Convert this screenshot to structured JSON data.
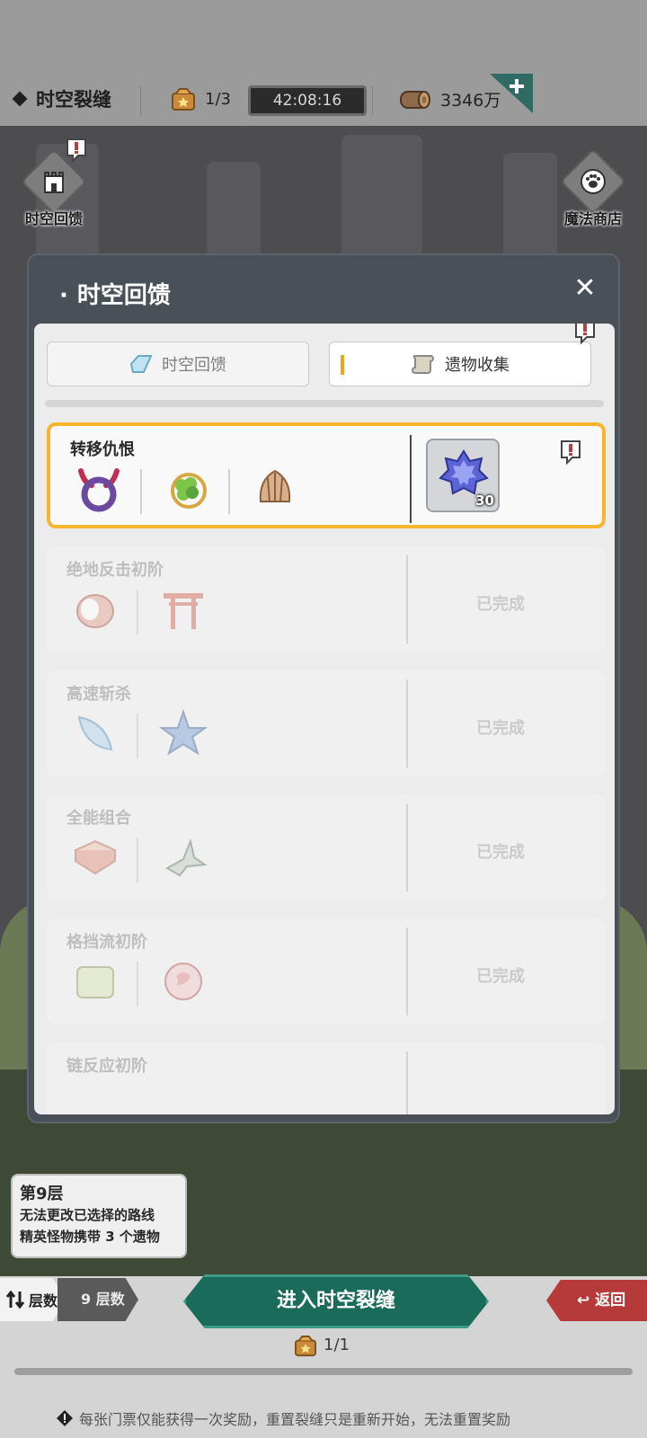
{
  "header": {
    "stage_name": "时空裂缝",
    "tickets": "1/3",
    "timer": "42:08:16",
    "wood_amount": "3346万"
  },
  "side_buttons": {
    "left_label": "时空回馈",
    "right_label": "魔法商店"
  },
  "modal": {
    "title": "时空回馈",
    "tabs": [
      {
        "label": "时空回馈",
        "icon": "crystal-icon",
        "selected": false
      },
      {
        "label": "遗物收集",
        "icon": "scroll-icon",
        "selected": true
      }
    ],
    "cards": [
      {
        "title": "转移仇恨",
        "status": "current",
        "reward_count": "30",
        "icons": [
          "horned-ring-icon",
          "clover-amulet-icon",
          "shell-icon"
        ]
      },
      {
        "title": "绝地反击初阶",
        "status": "已完成",
        "icons": [
          "drum-icon",
          "torii-icon"
        ]
      },
      {
        "title": "高速斩杀",
        "status": "已完成",
        "icons": [
          "feather-blade-icon",
          "star-icon"
        ]
      },
      {
        "title": "全能组合",
        "status": "已完成",
        "icons": [
          "book-icon",
          "bird-icon"
        ]
      },
      {
        "title": "格挡流初阶",
        "status": "已完成",
        "icons": [
          "scroll-block-icon",
          "rose-icon"
        ]
      },
      {
        "title": "链反应初阶",
        "status": "",
        "icons": []
      }
    ]
  },
  "floor_info": {
    "heading": "第9层",
    "line1": "无法更改已选择的路线",
    "line2": "精英怪物携带 3 个遗物"
  },
  "bottom": {
    "layer_label": "层数",
    "layer_value": "9 层数",
    "enter_label": "进入时空裂缝",
    "back_label": "返回",
    "ticket_count": "1/1",
    "notice": "每张门票仅能获得一次奖励，重置裂缝只是重新开始，无法重置奖励"
  },
  "colors": {
    "accent_orange": "#f6b52c",
    "enter_green": "#1b6b5a",
    "back_red": "#b73a3a",
    "modal_dark": "#4a5058"
  }
}
